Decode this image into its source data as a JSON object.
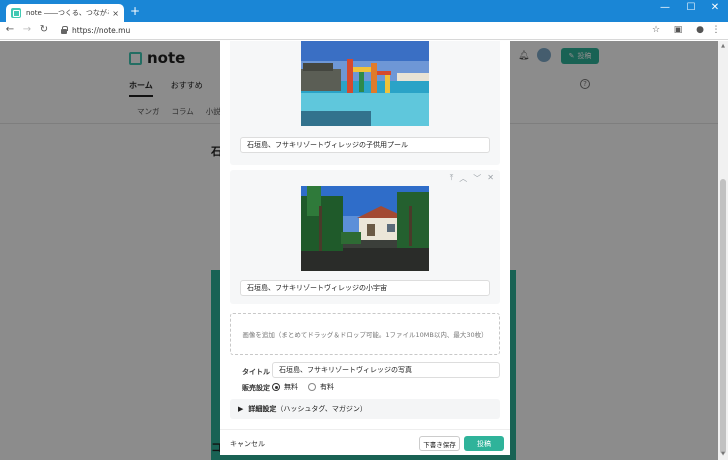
{
  "browser": {
    "tab_title": "note ――つくる、つながる、とどける。",
    "tab_close": "×",
    "new_tab": "+",
    "url": "https://note.mu",
    "window_controls": [
      "—",
      "☐",
      "✕"
    ]
  },
  "background_page": {
    "logo_text": "note",
    "nav_main": [
      "ホーム",
      "おすすめ"
    ],
    "nav_sub": [
      "マンガ",
      "コラム",
      "小説"
    ],
    "post_button": "投稿",
    "article_title_fragment": "石",
    "bottom_title_fragment": "コ"
  },
  "modal": {
    "images": [
      {
        "caption": "石垣島、フサキリゾートヴィレッジの子供用プール",
        "photo": "pool-icon"
      },
      {
        "caption": "石垣島、フサキリゾートヴィレッジの小宇宙",
        "photo": "villa-icon"
      }
    ],
    "block_controls": [
      "⤒",
      "︿",
      "﹀",
      "✕"
    ],
    "dropzone_text": "画像を追加（まとめてドラッグ＆ドロップ可能。1ファイル10MB以内、最大30枚）",
    "title_label": "タイトル",
    "title_value": "石垣島、フサキリゾートヴィレッジの写真",
    "sales_label": "販売設定",
    "sales_options": [
      "無料",
      "有料"
    ],
    "sales_selected": "無料",
    "details_label": "詳細設定",
    "details_sub": "（ハッシュタグ、マガジン）",
    "cancel": "キャンセル",
    "draft": "下書き保存",
    "submit": "投稿"
  },
  "colors": {
    "accent": "#2fb39a",
    "chrome": "#1a86d6"
  }
}
